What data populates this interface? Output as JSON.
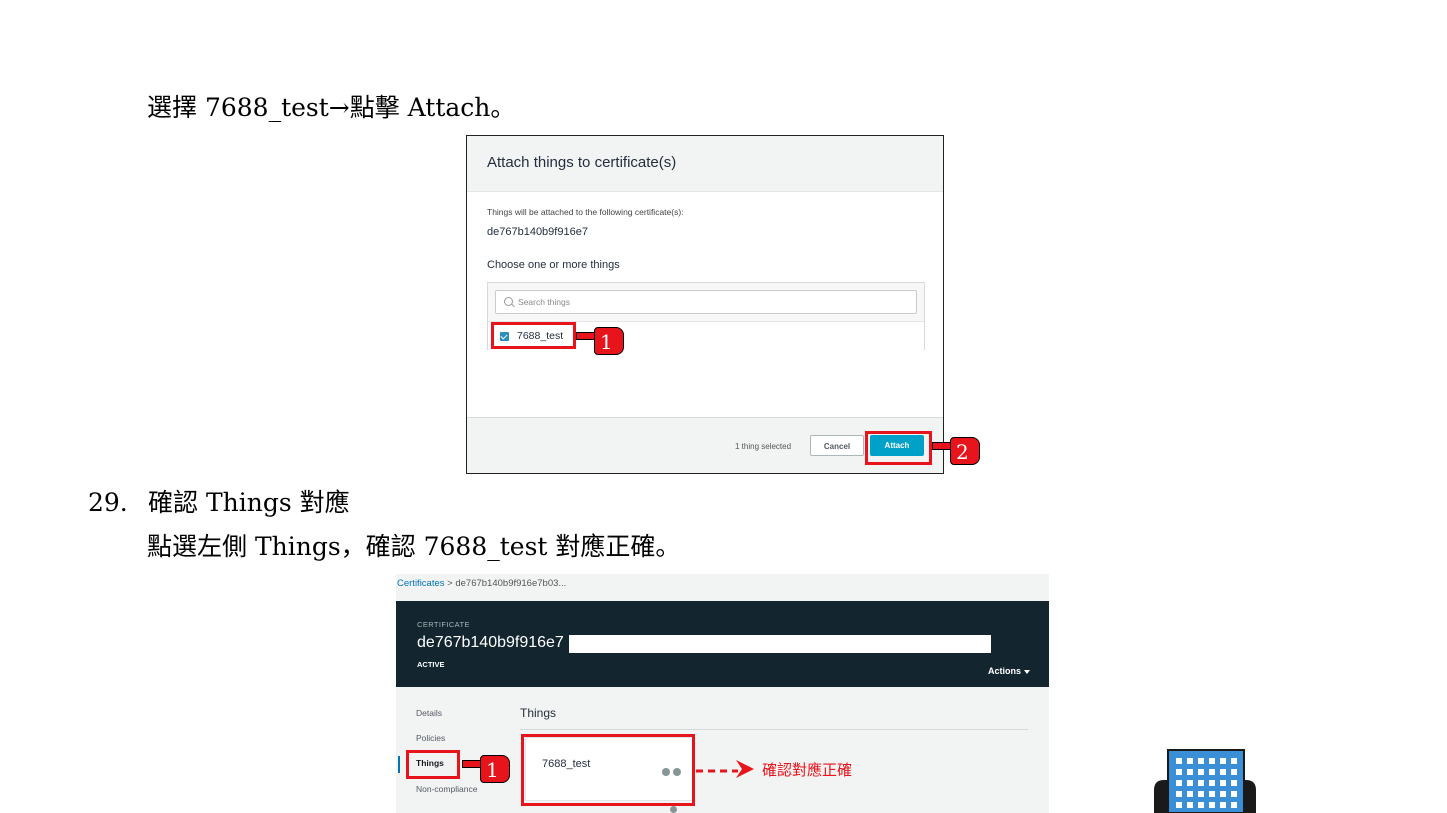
{
  "doc": {
    "line1": "選擇 7688_test→點擊 Attach。",
    "step_number": "29.",
    "step_title": "確認 Things 對應",
    "line3": "點選左側 Things，確認 7688_test 對應正確。"
  },
  "dialog": {
    "title": "Attach things to certificate(s)",
    "subtitle": "Things will be attached to the following certificate(s):",
    "certificate_id": "de767b140b9f916e7",
    "choose_label": "Choose one or more things",
    "search_placeholder": "Search things",
    "thing_label": "7688_test",
    "selected_count": "1 thing selected",
    "cancel_label": "Cancel",
    "attach_label": "Attach",
    "marker_1": "1",
    "marker_2": "2"
  },
  "console": {
    "breadcrumb_link": "Certificates",
    "breadcrumb_separator": ">",
    "breadcrumb_current": "de767b140b9f916e7b03...",
    "header_label": "CERTIFICATE",
    "certificate_id": "de767b140b9f916e7",
    "status": "ACTIVE",
    "actions_label": "Actions",
    "nav": [
      "Details",
      "Policies",
      "Things",
      "Non-compliance"
    ],
    "section_title": "Things",
    "thing_label": "7688_test",
    "marker_1": "1",
    "confirm_note": "確認對應正確"
  },
  "colors": {
    "annotation_red": "#e8141b",
    "aws_header": "#13252f",
    "aws_primary_button": "#00a1c9",
    "link_blue": "#0073bb"
  }
}
